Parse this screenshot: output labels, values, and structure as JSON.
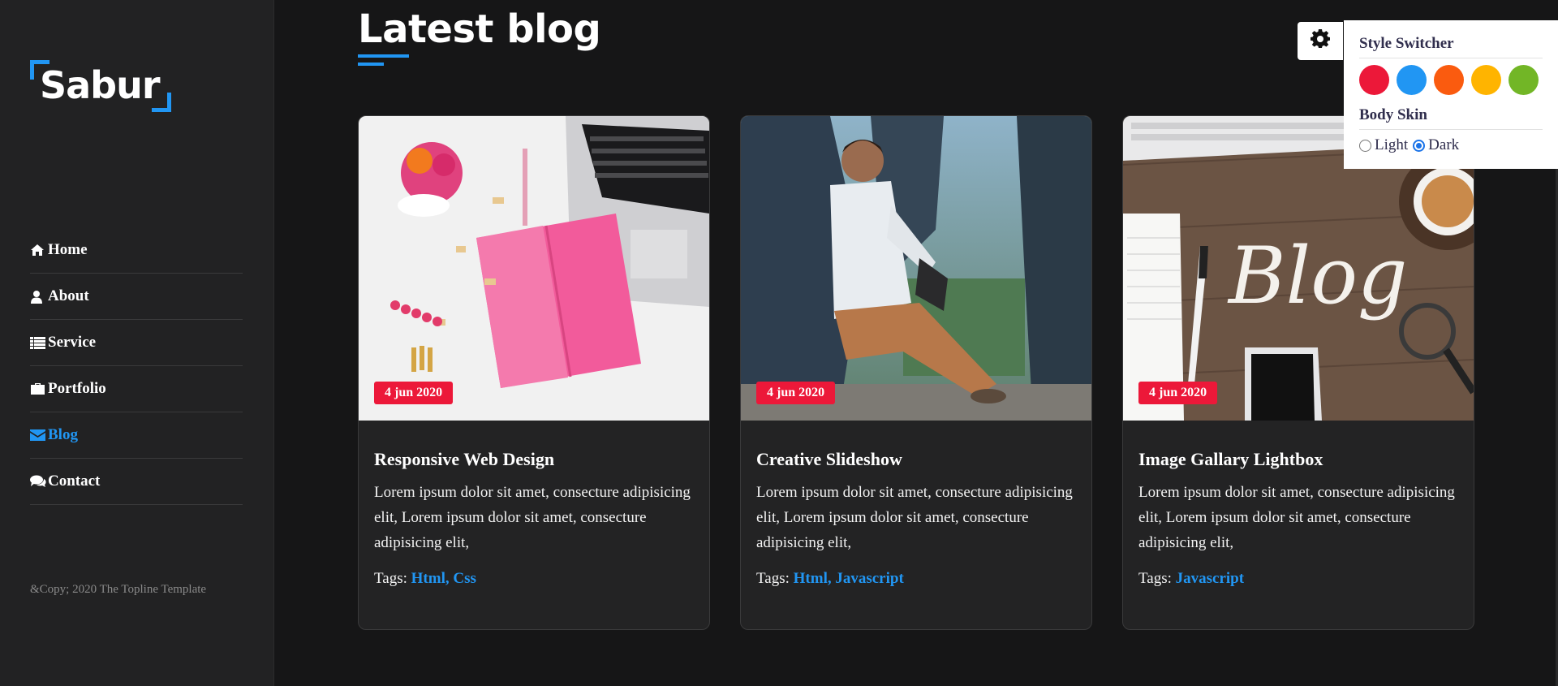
{
  "sidebar": {
    "logo": "Sabur",
    "nav": [
      {
        "label": "Home",
        "icon": "home-icon",
        "active": false
      },
      {
        "label": "About",
        "icon": "user-icon",
        "active": false
      },
      {
        "label": "Service",
        "icon": "list-icon",
        "active": false
      },
      {
        "label": "Portfolio",
        "icon": "briefcase-icon",
        "active": false
      },
      {
        "label": "Blog",
        "icon": "envelope-icon",
        "active": true
      },
      {
        "label": "Contact",
        "icon": "comments-icon",
        "active": false
      }
    ],
    "copyright": "&Copy; 2020 The Topline Template"
  },
  "main": {
    "title": "Latest blog",
    "posts": [
      {
        "date": "4 jun 2020",
        "title": "Responsive Web Design",
        "excerpt": "Lorem ipsum dolor sit amet, consecture adipisicing elit, Lorem ipsum dolor sit amet, consecture adipisicing elit,",
        "tags_label": "Tags:",
        "tags": "Html, Css"
      },
      {
        "date": "4 jun 2020",
        "title": "Creative Slideshow",
        "excerpt": "Lorem ipsum dolor sit amet, consecture adipisicing elit, Lorem ipsum dolor sit amet, consecture adipisicing elit,",
        "tags_label": "Tags:",
        "tags": "Html, Javascript"
      },
      {
        "date": "4 jun 2020",
        "title": "Image Gallary Lightbox",
        "excerpt": "Lorem ipsum dolor sit amet, consecture adipisicing elit, Lorem ipsum dolor sit amet, consecture adipisicing elit,",
        "tags_label": "Tags:",
        "tags": "Javascript"
      }
    ]
  },
  "style_switcher": {
    "title": "Style Switcher",
    "colors": [
      "#ec1839",
      "#2196f3",
      "#fa5b0f",
      "#ffb400",
      "#72b626"
    ],
    "skin_title": "Body Skin",
    "skin_options": [
      "Light",
      "Dark"
    ],
    "skin_selected": "Dark",
    "gear_icon": "gear-icon"
  },
  "theme": {
    "accent": "#2196f3",
    "date_badge": "#ec1839",
    "background": "#161617",
    "sidebar_bg": "#222223"
  }
}
